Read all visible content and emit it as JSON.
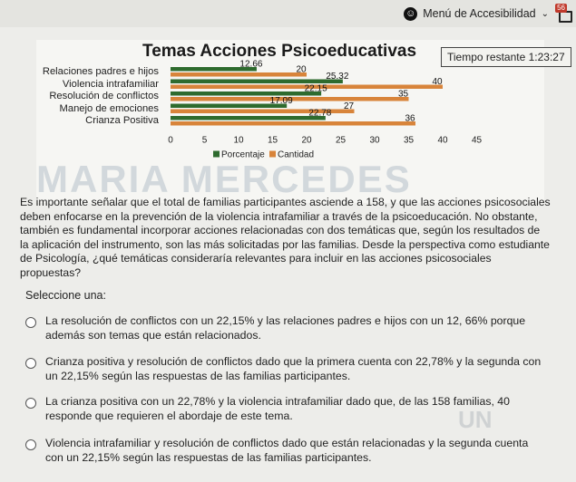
{
  "topbar": {
    "accessibility_label": "Menú de Accesibilidad",
    "notification_count": "56"
  },
  "figure": {
    "watermark": "MARIA MERCEDES",
    "timer": {
      "label": "Tiempo restante",
      "value": "1:23:27"
    }
  },
  "chart_data": {
    "type": "bar",
    "title": "Temas Acciones Psicoeducativas",
    "orientation": "horizontal",
    "categories": [
      "Relaciones padres e hijos",
      "Violencia intrafamiliar",
      "Resolución de conflictos",
      "Manejo de emociones",
      "Crianza Positiva"
    ],
    "series": [
      {
        "name": "Porcentaje",
        "values": [
          12.66,
          25.32,
          22.15,
          17.09,
          22.78
        ],
        "labels": [
          "12.66",
          "25.32",
          "22.15",
          "17.09",
          "22.78"
        ],
        "color": "#2e6b2e"
      },
      {
        "name": "Cantidad",
        "values": [
          20,
          40,
          35,
          27,
          36
        ],
        "labels": [
          "20",
          "40",
          "35",
          "27",
          "36"
        ],
        "color": "#d8843a"
      }
    ],
    "xticks": [
      0,
      5,
      10,
      15,
      20,
      25,
      30,
      35,
      40,
      45
    ],
    "xlim": [
      0,
      45
    ],
    "legend": "bottom"
  },
  "question": {
    "text": "Es importante señalar que el total de familias participantes asciende a 158, y que las acciones psicosociales deben enfocarse en la prevención de la violencia intrafamiliar a través de la psicoeducación. No obstante, también es fundamental incorporar acciones relacionadas con dos temáticas que, según los resultados de la aplicación del instrumento, son las más solicitadas por las familias. Desde la perspectiva como estudiante de Psicología, ¿qué temáticas consideraría relevantes para incluir en las acciones psicosociales propuestas?",
    "prompt": "Seleccione una:",
    "options": [
      "La resolución de conflictos con un 22,15% y las relaciones padres e hijos con un 12, 66% porque además son temas que están relacionados.",
      "Crianza positiva y resolución de conflictos dado que la primera cuenta con 22,78% y la segunda con un 22,15% según las respuestas de las familias participantes.",
      "La crianza positiva con un 22,78% y la violencia intrafamiliar dado que, de las 158 familias, 40 responde que requieren el abordaje de este tema.",
      "Violencia intrafamiliar y resolución de conflictos dado que están relacionadas y la segunda cuenta con un 22,15% según las respuestas de las familias participantes."
    ],
    "stamp": "UN"
  }
}
